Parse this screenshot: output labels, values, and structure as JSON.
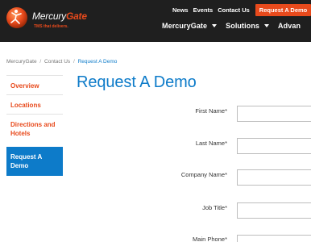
{
  "header": {
    "logo": {
      "name_prefix": "Mercury",
      "name_suffix": "Gate",
      "tagline": "TMS that delivers."
    },
    "utility_links": [
      "News",
      "Events",
      "Contact Us"
    ],
    "cta_label": "Request A Demo",
    "nav": [
      {
        "label": "MercuryGate"
      },
      {
        "label": "Solutions"
      },
      {
        "label": "Advan"
      }
    ]
  },
  "breadcrumb": {
    "items": [
      "MercuryGate",
      "Contact Us"
    ],
    "current": "Request A Demo",
    "separator": "/"
  },
  "sidebar": {
    "items": [
      {
        "label": "Overview",
        "active": false
      },
      {
        "label": "Locations",
        "active": false
      },
      {
        "label": "Directions and Hotels",
        "active": false
      },
      {
        "label": "Request A Demo",
        "active": true
      }
    ]
  },
  "main": {
    "title": "Request A Demo",
    "fields": [
      {
        "label": "First Name*",
        "value": ""
      },
      {
        "label": "Last Name*",
        "value": ""
      },
      {
        "label": "Company Name*",
        "value": ""
      },
      {
        "label": "Job Title*",
        "value": ""
      },
      {
        "label": "Main Phone*",
        "value": ""
      }
    ]
  },
  "colors": {
    "accent_orange": "#e84a1c",
    "accent_blue": "#0d7bc9",
    "header_bg": "#1f1f1f"
  }
}
